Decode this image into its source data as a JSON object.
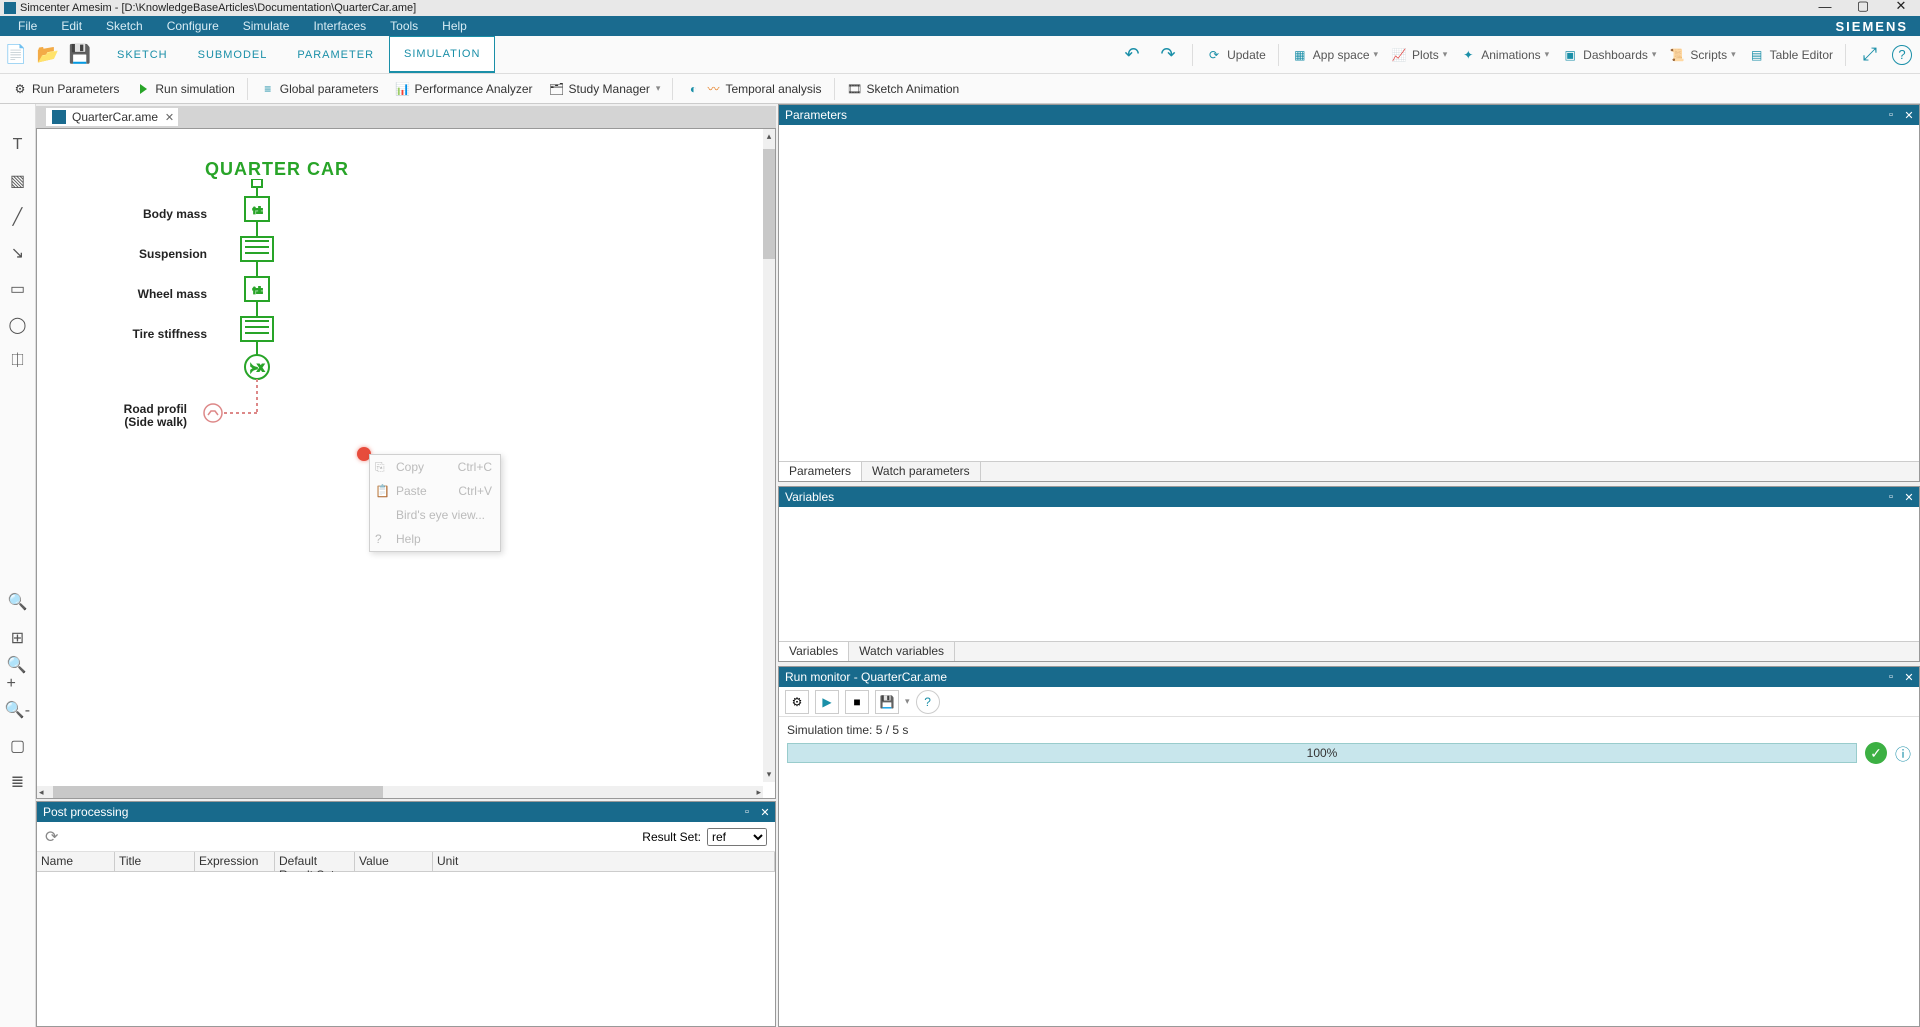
{
  "title": "Simcenter Amesim - [D:\\KnowledgeBaseArticles\\Documentation\\QuarterCar.ame]",
  "brand": "SIEMENS",
  "menus": [
    "File",
    "Edit",
    "Sketch",
    "Configure",
    "Simulate",
    "Interfaces",
    "Tools",
    "Help"
  ],
  "mode_tabs": [
    "SKETCH",
    "SUBMODEL",
    "PARAMETER",
    "SIMULATION"
  ],
  "mode_active": "SIMULATION",
  "toolbar_right": {
    "update": "Update",
    "app_space": "App space",
    "plots": "Plots",
    "animations": "Animations",
    "dashboards": "Dashboards",
    "scripts": "Scripts",
    "table_editor": "Table Editor"
  },
  "ribbon": {
    "run_parameters": "Run Parameters",
    "run_simulation": "Run simulation",
    "global_parameters": "Global parameters",
    "perf_analyzer": "Performance Analyzer",
    "study_manager": "Study Manager",
    "temporal": "Temporal analysis",
    "sketch_anim": "Sketch Animation"
  },
  "doc_tab": "QuarterCar.ame",
  "diagram": {
    "title": "QUARTER CAR",
    "labels": {
      "body_mass": "Body mass",
      "suspension": "Suspension",
      "wheel_mass": "Wheel mass",
      "tire_stiffness": "Tire stiffness",
      "road_profil_1": "Road profil",
      "road_profil_2": "(Side walk)"
    }
  },
  "context_menu": {
    "copy": "Copy",
    "copy_shortcut": "Ctrl+C",
    "paste": "Paste",
    "paste_shortcut": "Ctrl+V",
    "birds_eye": "Bird's eye view...",
    "help": "Help"
  },
  "panels": {
    "parameters": "Parameters",
    "watch_parameters": "Watch parameters",
    "variables": "Variables",
    "watch_variables": "Watch variables",
    "run_monitor": "Run monitor - QuarterCar.ame",
    "post_processing": "Post processing"
  },
  "post_processing": {
    "result_set_label": "Result Set:",
    "result_set_value": "ref",
    "cols": [
      "Name",
      "Title",
      "Expression",
      "Default Result Set",
      "Value",
      "Unit"
    ]
  },
  "run_monitor": {
    "sim_time": "Simulation time: 5 / 5 s",
    "progress": "100%"
  }
}
